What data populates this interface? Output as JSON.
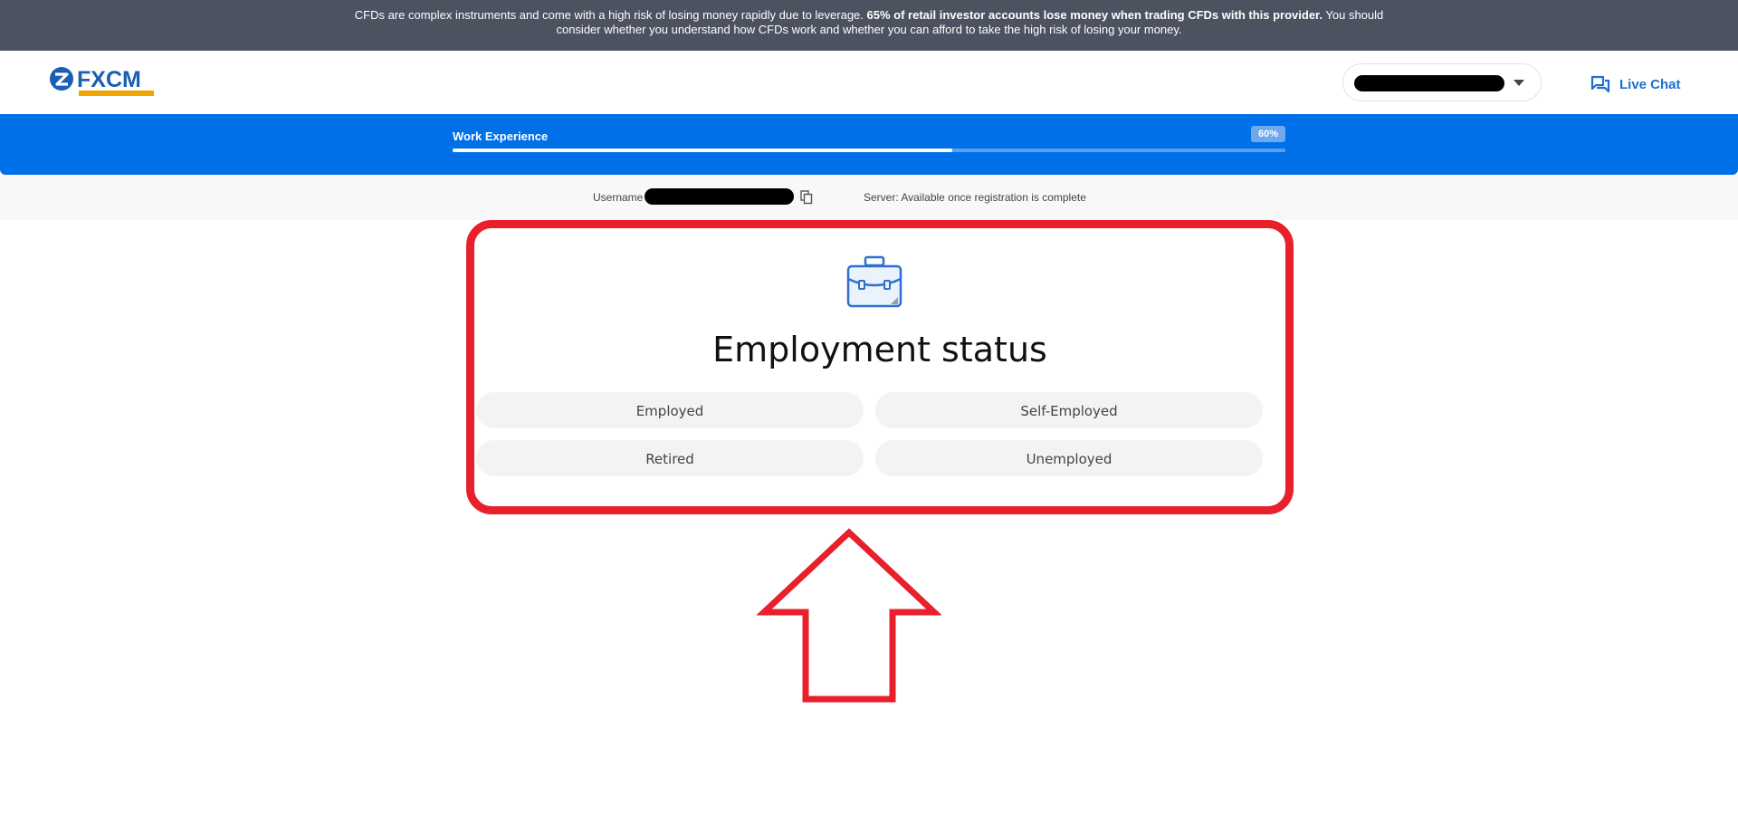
{
  "banner": {
    "text_start": "CFDs are complex instruments and come with a high risk of losing money rapidly due to leverage. ",
    "text_bold": "65% of retail investor accounts lose money when trading CFDs with this provider.",
    "text_end": " You should consider whether you understand how CFDs work and whether you can afford to take the high risk of losing your money."
  },
  "header": {
    "logo_text": "FXCM",
    "live_chat_label": "Live Chat"
  },
  "progress": {
    "title": "Work Experience",
    "percent_label": "60%",
    "fraction": 0.6
  },
  "info": {
    "username_label": "Username",
    "server_text": "Server: Available once registration is complete"
  },
  "card": {
    "title": "Employment status",
    "options": [
      "Employed",
      "Self-Employed",
      "Retired",
      "Unemployed"
    ]
  },
  "colors": {
    "banner_bg": "#4d5261",
    "progress_bg": "#0070e8",
    "accent_blue": "#1a6fd0",
    "highlight_red": "#e8202b"
  }
}
